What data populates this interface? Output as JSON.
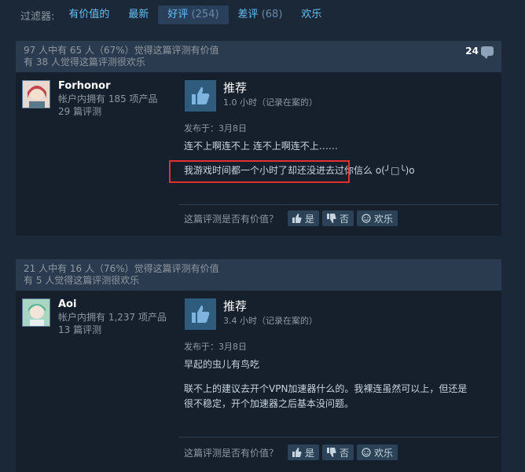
{
  "filter": {
    "label": "过滤器:",
    "tabs": [
      {
        "label": "有价值的",
        "count": ""
      },
      {
        "label": "最新",
        "count": ""
      },
      {
        "label": "好评",
        "count": "(254)"
      },
      {
        "label": "差评",
        "count": "(68)"
      },
      {
        "label": "欢乐",
        "count": ""
      }
    ],
    "active_index": 2
  },
  "reviews": [
    {
      "helpful_line1": "97 人中有 65 人（67%）觉得这篇评测有价值",
      "helpful_line2": "有 38 人觉得这篇评测很欢乐",
      "comment_count": "24",
      "author": {
        "name": "Forhonor",
        "products": "帐户内拥有 185 项产品",
        "reviews": "29 篇评测"
      },
      "verdict": "推荐",
      "hours": "1.0 小时（记录在案的）",
      "posted": "发布于：3月8日",
      "content": [
        "连不上啊连不上 连不上啊连不上……",
        "我游戏时间都一个小时了却还没进去过你信么 o(╯□╰)o"
      ],
      "vote": {
        "question": "这篇评测是否有价值？",
        "yes": "是",
        "no": "否",
        "funny": "欢乐"
      }
    },
    {
      "helpful_line1": "21 人中有 16 人（76%）觉得这篇评测有价值",
      "helpful_line2": "有 5 人觉得这篇评测很欢乐",
      "comment_count": "",
      "author": {
        "name": "Aoi",
        "products": "帐户内拥有 1,237 项产品",
        "reviews": "13 篇评测"
      },
      "verdict": "推荐",
      "hours": "3.4 小时（记录在案的）",
      "posted": "发布于：3月8日",
      "content": [
        "早起的虫儿有鸟吃",
        "",
        "联不上的建议去开个VPN加速器什么的。我裸连虽然可以上，但还是",
        "很不稳定，开个加速器之后基本没问题。"
      ],
      "vote": {
        "question": "这篇评测是否有价值？",
        "yes": "是",
        "no": "否",
        "funny": "欢乐"
      }
    }
  ],
  "colors": {
    "highlight": "#e03030",
    "accent": "#66c0f4",
    "background": "#1b2838"
  }
}
